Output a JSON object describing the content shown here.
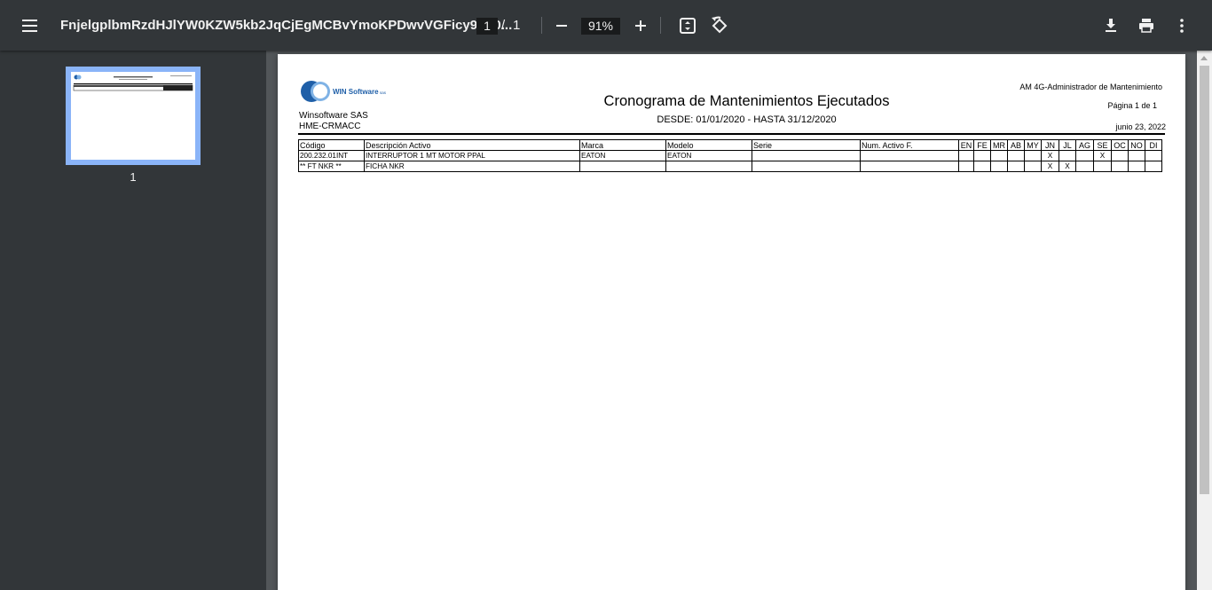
{
  "toolbar": {
    "title": "FnjelgplbmRzdHJlYW0KZW5kb2JqCjEgMCBvYmoKPDwvVGFicy9TL0...",
    "page_current": "1",
    "page_separator": "/",
    "page_total": "1",
    "zoom": "91%"
  },
  "sidebar": {
    "thumbnail_label": "1"
  },
  "report": {
    "company": "Winsoftware SAS",
    "company_code": "HME-CRMACC",
    "title": "Cronograma de Mantenimientos Ejecutados",
    "range": "DESDE: 01/01/2020 -  HASTA 31/12/2020",
    "app_name": "AM 4G-Administrador de Mantenimiento",
    "page_info": "Página 1 de 1",
    "date": "junio 23, 2022",
    "logo_text": "WIN Software",
    "logo_suffix": "sas",
    "columns": [
      "Código",
      "Descripción Activo",
      "Marca",
      "Modelo",
      "Serie",
      "Num. Activo F.",
      "EN",
      "FE",
      "MR",
      "AB",
      "MY",
      "JN",
      "JL",
      "AG",
      "SE",
      "OC",
      "NO",
      "DI"
    ],
    "rows": [
      [
        "200.232.01INT",
        "INTERRUPTOR 1 MT MOTOR PPAL",
        "EATON",
        "EATON",
        "",
        "",
        "",
        "",
        "",
        "",
        "",
        "X",
        "",
        "",
        "X",
        "",
        "",
        ""
      ],
      [
        "** FT NKR **",
        "FICHA NKR",
        "",
        "",
        "",
        "",
        "",
        "",
        "",
        "",
        "",
        "X",
        "X",
        "",
        "",
        "",
        "",
        ""
      ]
    ]
  },
  "colors": {
    "toolbar_bg": "#323639",
    "viewer_bg": "#525659",
    "thumb_highlight": "#8ab4f8",
    "logo_blue": "#1f5fa8"
  },
  "icons": [
    "menu-icon",
    "zoom-out-icon",
    "zoom-in-icon",
    "fit-page-icon",
    "rotate-icon",
    "download-icon",
    "print-icon",
    "more-vert-icon"
  ]
}
